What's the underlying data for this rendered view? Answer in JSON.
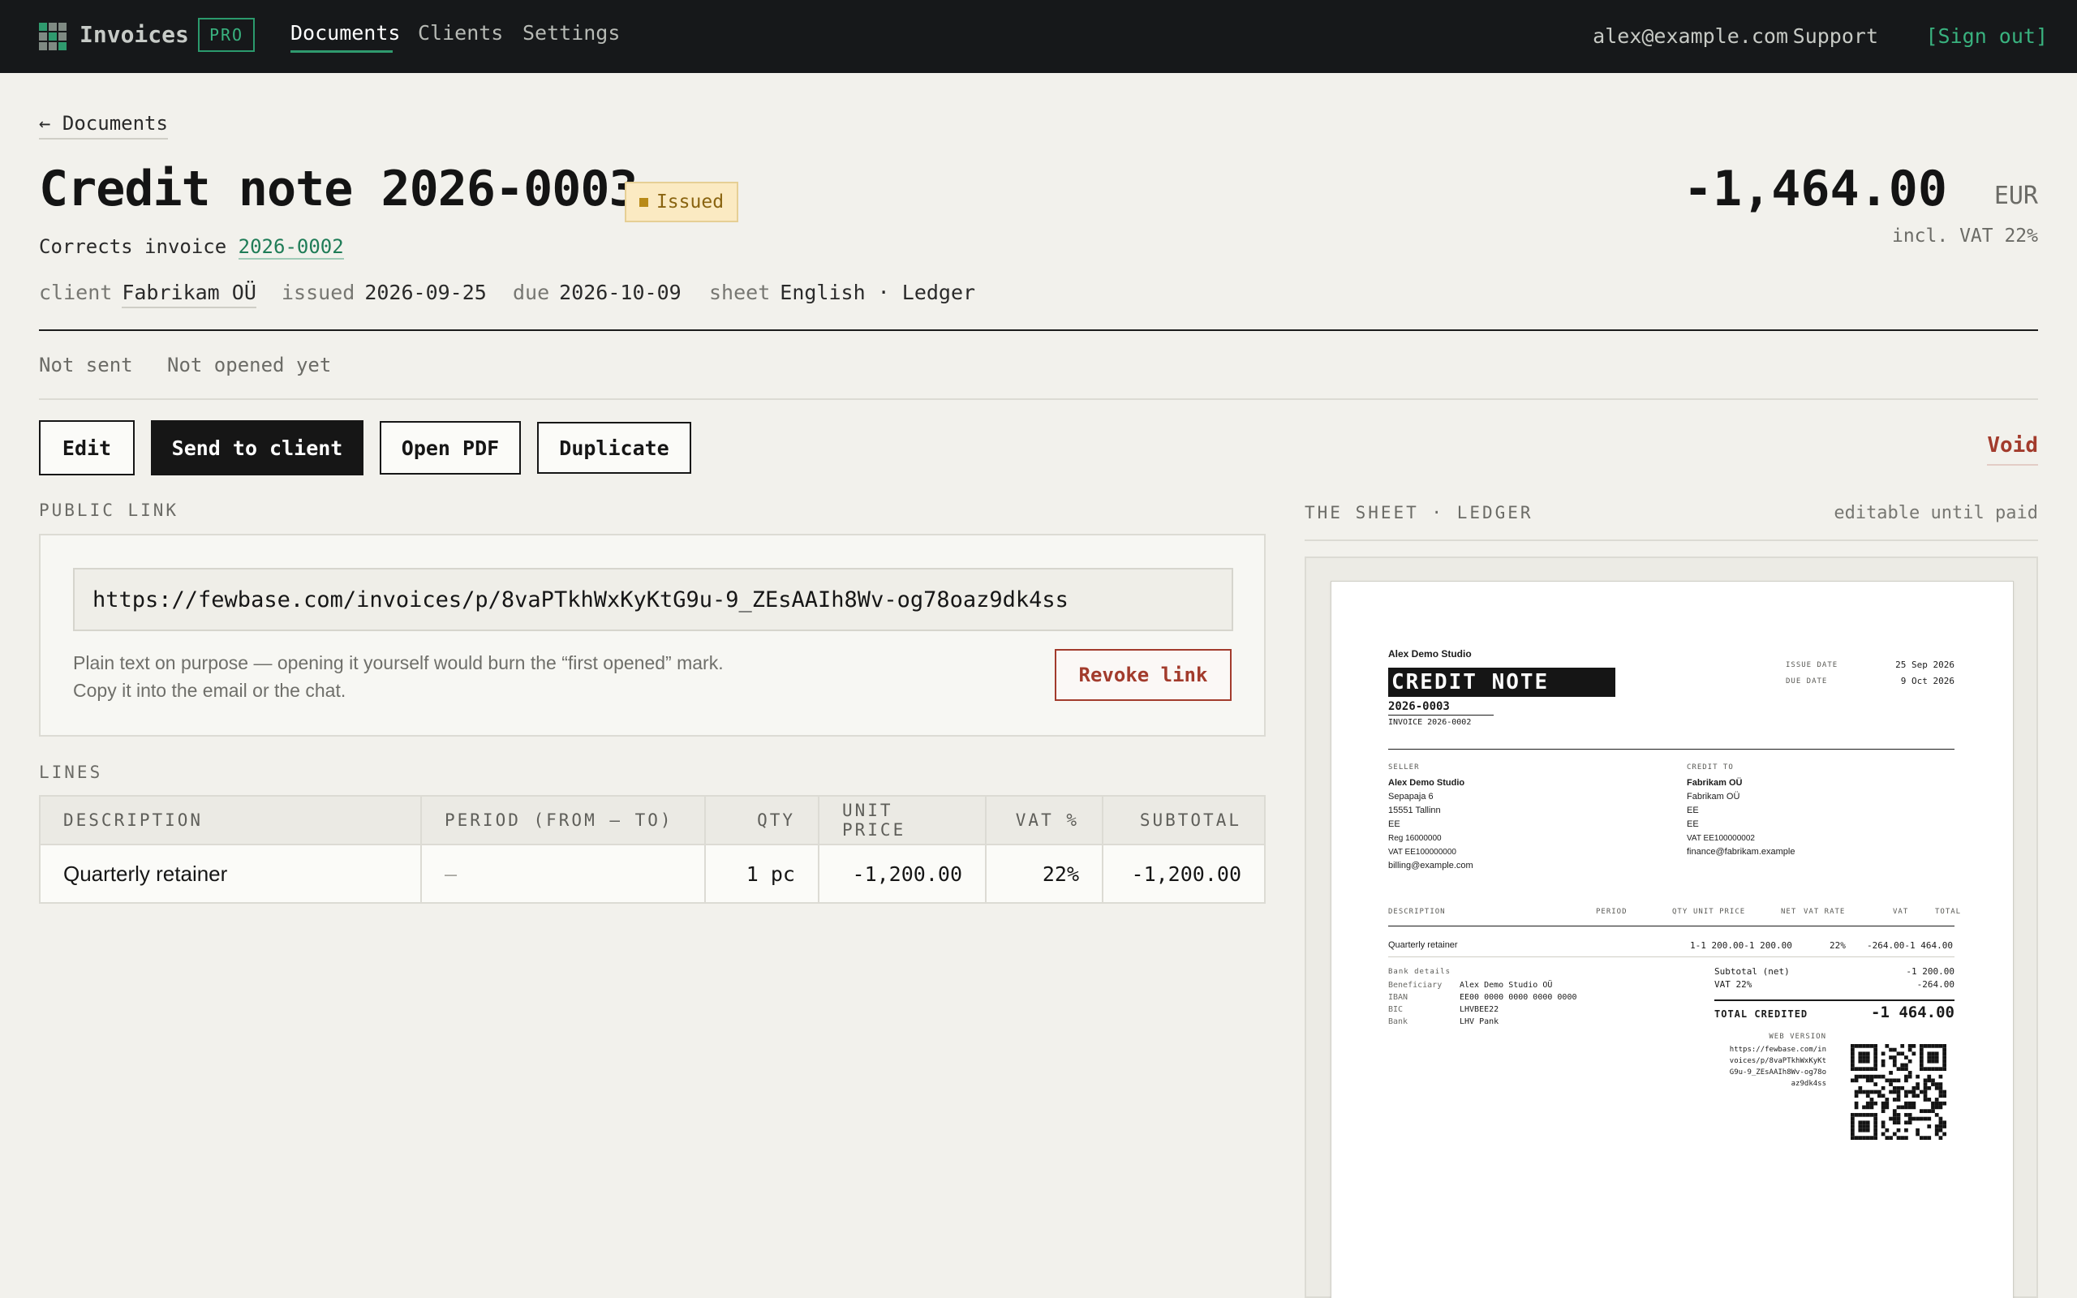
{
  "nav": {
    "brand": "Invoices",
    "badge": "PRO",
    "items": [
      "Documents",
      "Clients",
      "Settings"
    ],
    "email": "alex@example.com",
    "support": "Support",
    "signout": "[Sign out]"
  },
  "header": {
    "back": "← Documents",
    "title": "Credit note 2026-0003",
    "status": "Issued",
    "amount": "-1,464.00",
    "currency": "EUR",
    "vat_note": "incl. VAT 22%",
    "corrects_label": "Corrects invoice",
    "corrects_invoice": "2026-0002",
    "meta": {
      "client_label": "client",
      "client": "Fabrikam OÜ",
      "issued_label": "issued",
      "issued": "2026-09-25",
      "due_label": "due",
      "due": "2026-10-09",
      "sheet_label": "sheet",
      "sheet": "English · Ledger"
    },
    "sent_status": "Not sent",
    "opened_status": "Not opened yet"
  },
  "actions": {
    "edit": "Edit",
    "send": "Send to client",
    "pdf": "Open PDF",
    "duplicate": "Duplicate",
    "void": "Void"
  },
  "public_link": {
    "label": "PUBLIC LINK",
    "url": "https://fewbase.com/invoices/p/8vaPTkhWxKyKtG9u-9_ZEsAAIh8Wv-og78oaz9dk4ss",
    "help_1": "Plain text on purpose — opening it yourself would burn the “first opened” mark.",
    "help_2": "Copy it into the email or the chat.",
    "revoke": "Revoke link"
  },
  "lines": {
    "label": "LINES",
    "columns": [
      "DESCRIPTION",
      "PERIOD (FROM — TO)",
      "QTY",
      "UNIT PRICE",
      "VAT %",
      "SUBTOTAL"
    ],
    "rows": [
      [
        "Quarterly retainer",
        "—",
        "1 pc",
        "-1,200.00",
        "22%",
        "-1,200.00"
      ]
    ]
  },
  "sheet": {
    "label": "THE SHEET · LEDGER",
    "note": "editable until paid",
    "seller_name": "Alex Demo Studio",
    "doc_title": "CREDIT NOTE",
    "doc_number": "2026-0003",
    "ref": "INVOICE 2026-0002",
    "issue_date_label": "ISSUE DATE",
    "issue_date": "25 Sep 2026",
    "due_date_label": "DUE DATE",
    "due_date": "9 Oct 2026",
    "seller_label": "SELLER",
    "seller_lines": [
      "Alex Demo Studio",
      "Sepapaja 6",
      "15551 Tallinn",
      "EE",
      "Reg 16000000",
      "VAT EE100000000",
      "billing@example.com"
    ],
    "credit_to_label": "CREDIT TO",
    "buyer_lines": [
      "Fabrikam OÜ",
      "Fabrikam OÜ",
      "EE",
      "EE",
      "VAT EE100000002",
      "finance@fabrikam.example"
    ],
    "cols": [
      "DESCRIPTION",
      "PERIOD",
      "QTY",
      "UNIT PRICE",
      "NET",
      "VAT RATE",
      "VAT",
      "TOTAL"
    ],
    "line_desc": "Quarterly retainer",
    "line_vals": "1-1 200.00-1 200.00",
    "line_rate": "22%",
    "line_tail": "-264.00-1 464.00",
    "bank_label": "Bank details",
    "bank": [
      [
        "Beneficiary",
        "Alex Demo Studio OÜ"
      ],
      [
        "IBAN",
        "EE00 0000 0000 0000 0000"
      ],
      [
        "BIC",
        "LHVBEE22"
      ],
      [
        "Bank",
        "LHV Pank"
      ]
    ],
    "subtotal_label": "Subtotal (net)",
    "subtotal": "-1 200.00",
    "vat_label": "VAT 22%",
    "vat": "-264.00",
    "total_label": "TOTAL CREDITED",
    "total": "-1 464.00",
    "web_label": "WEB VERSION",
    "web_url": [
      "https://fewbase.com/in",
      "voices/p/8vaPTkhWxKyKt",
      "G9u-9_ZEsAAIh8Wv-og78o",
      "az9dk4ss"
    ]
  },
  "icons": {
    "logo": "grid-logo-icon"
  },
  "colors": {
    "accent": "#2f9a6e",
    "danger": "#a23b2c",
    "badge_bg": "#fbeac2",
    "topbar": "#16181a"
  }
}
